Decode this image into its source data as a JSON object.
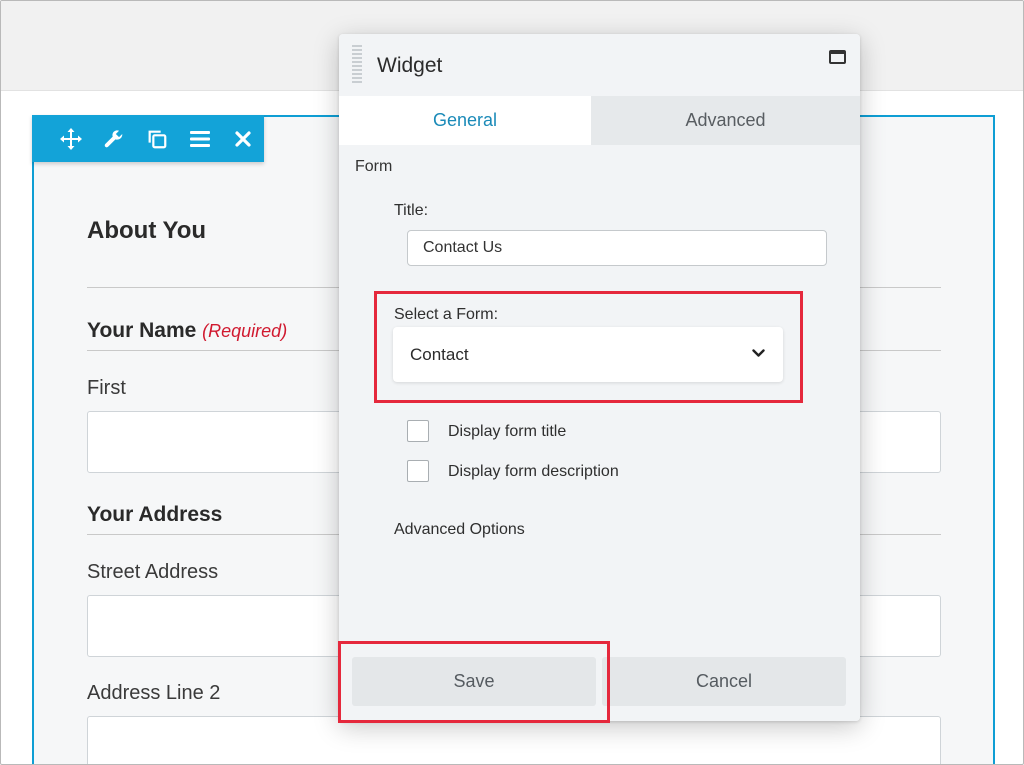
{
  "toolbar": {
    "icons": [
      "move-icon",
      "wrench-icon",
      "duplicate-icon",
      "menu-icon",
      "close-icon"
    ]
  },
  "form": {
    "heading": "About You",
    "name_section": "Your Name",
    "required": "(Required)",
    "first_label": "First",
    "address_section": "Your Address",
    "street_label": "Street Address",
    "line2_label": "Address Line 2"
  },
  "dialog": {
    "title": "Widget",
    "tabs": [
      "General",
      "Advanced"
    ],
    "section": "Form",
    "title_label": "Title:",
    "title_value": "Contact Us",
    "select_label": "Select a Form:",
    "select_value": "Contact",
    "checkboxes": [
      "Display form title",
      "Display form description"
    ],
    "advanced_options": "Advanced Options",
    "save_label": "Save",
    "cancel_label": "Cancel"
  },
  "colors": {
    "accent": "#13a3d8",
    "tab_active_text": "#1a8ab8",
    "highlight": "#e5283c",
    "required": "#d0192f"
  }
}
